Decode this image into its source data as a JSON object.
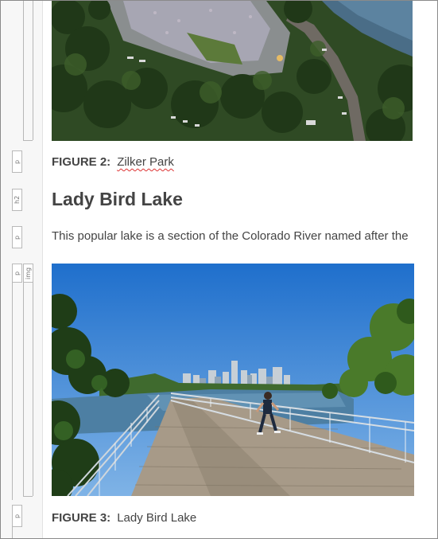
{
  "block_tags": [
    "p",
    "h2",
    "p",
    "p",
    "img",
    "p"
  ],
  "figure2": {
    "label": "FIGURE 2:",
    "caption": "Zilker Park",
    "image_name": "zilker-park-aerial-photo"
  },
  "heading": "Lady Bird Lake",
  "paragraph": "This popular lake is a section of the Colorado River named after the",
  "figure3": {
    "label": "FIGURE 3:",
    "caption": "Lady Bird Lake",
    "image_name": "lady-bird-lake-boardwalk-photo"
  },
  "colors": {
    "text": "#444444",
    "spellcheck_underline": "#dd3333",
    "gutter": "#f7f7f7"
  }
}
